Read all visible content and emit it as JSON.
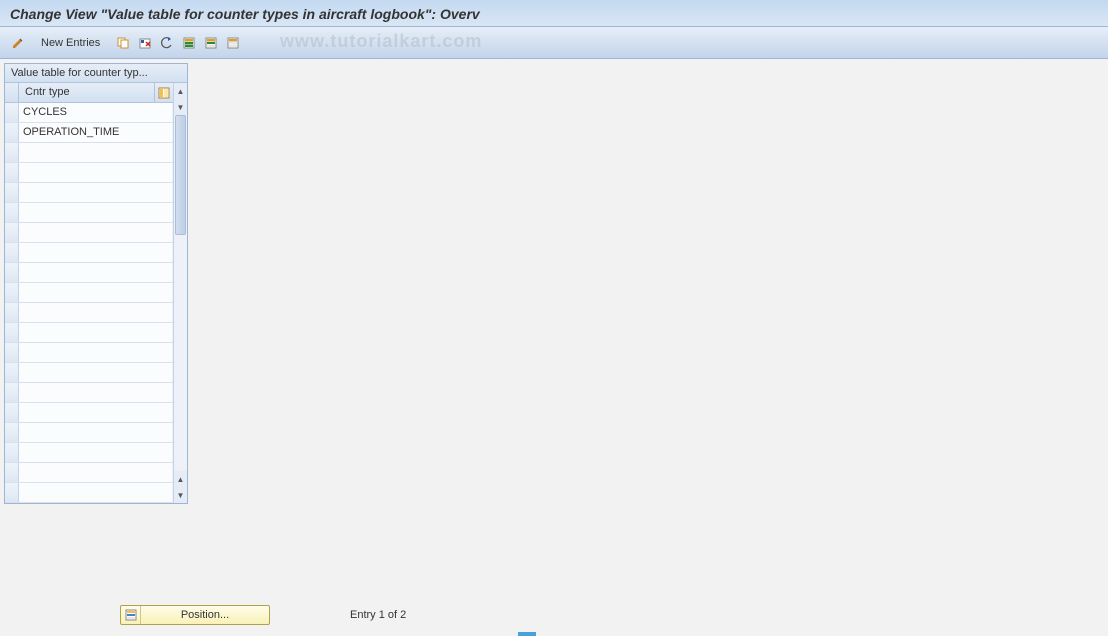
{
  "title": "Change View \"Value table for counter types in aircraft logbook\": Overv",
  "watermark": "www.tutorialkart.com",
  "toolbar": {
    "new_entries_label": "New Entries"
  },
  "panel": {
    "title": "Value table for counter typ...",
    "column_header": "Cntr type",
    "rows": [
      "CYCLES",
      "OPERATION_TIME",
      "",
      "",
      "",
      "",
      "",
      "",
      "",
      "",
      "",
      "",
      "",
      "",
      "",
      "",
      "",
      "",
      "",
      ""
    ]
  },
  "footer": {
    "position_label": "Position...",
    "status": "Entry 1 of 2"
  }
}
